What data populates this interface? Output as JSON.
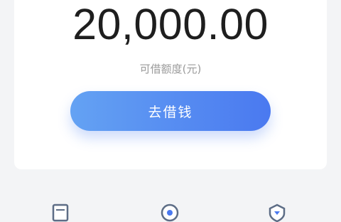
{
  "credit": {
    "amount": "20,000.00",
    "label": "可借额度(元)"
  },
  "actions": {
    "borrow_label": "去借钱"
  },
  "colors": {
    "button_start": "#64a2f3",
    "button_end": "#4a79f0",
    "amount_text": "#1e1e1e",
    "label_text": "#9a9a9a",
    "page_bg": "#f3f4f6",
    "card_bg": "#ffffff"
  },
  "bottom_icons": [
    "document-icon",
    "globe-icon",
    "shield-icon"
  ]
}
